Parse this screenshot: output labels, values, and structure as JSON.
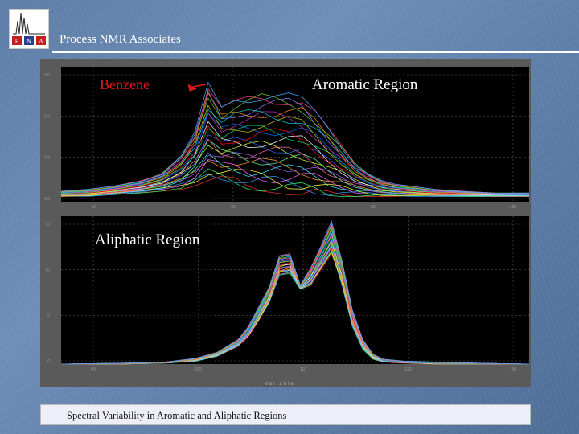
{
  "header": {
    "logo_letters": [
      "P",
      "N",
      "A"
    ],
    "title": "Process NMR Associates"
  },
  "caption": "Spectral Variability in Aromatic and Aliphatic Regions",
  "colors": {
    "plot_background": "#000000",
    "panel_background": "#5a5a5a",
    "annotation_red": "#e01818",
    "annotation_white": "#ffffff"
  },
  "chart_data": [
    {
      "type": "line",
      "region_label": "Aromatic Region",
      "annotation": {
        "text": "Benzene",
        "points_to_x": 41,
        "points_to_y": 0.66
      },
      "xlim": [
        20,
        90
      ],
      "ylim": [
        -0.02,
        0.75
      ],
      "yticks": [
        "0.0",
        "0.2",
        "0.4",
        "0.6"
      ],
      "xticks": [
        "40",
        "60",
        "80",
        "100"
      ],
      "x": [
        20,
        24,
        28,
        32,
        35,
        38,
        40,
        42,
        44,
        46,
        48,
        50,
        52,
        54,
        56,
        58,
        60,
        62,
        64,
        66,
        68,
        70,
        72,
        76,
        80,
        85,
        90
      ],
      "envelope_upper": [
        0.04,
        0.05,
        0.07,
        0.1,
        0.14,
        0.25,
        0.38,
        0.66,
        0.52,
        0.56,
        0.58,
        0.6,
        0.6,
        0.6,
        0.58,
        0.5,
        0.4,
        0.3,
        0.2,
        0.14,
        0.1,
        0.08,
        0.07,
        0.05,
        0.04,
        0.03,
        0.03
      ],
      "envelope_lower": [
        0.01,
        0.01,
        0.02,
        0.03,
        0.04,
        0.05,
        0.07,
        0.1,
        0.1,
        0.08,
        0.05,
        0.04,
        0.03,
        0.02,
        0.02,
        0.02,
        0.01,
        0.01,
        0.01,
        0.01,
        0.01,
        0.01,
        0.01,
        0.01,
        0.01,
        0.01,
        0.01
      ]
    },
    {
      "type": "line",
      "region_label": "Aliphatic Region",
      "xlim": [
        90,
        135
      ],
      "ylim": [
        0,
        1.5
      ],
      "yticks": [
        "0",
        "5",
        "10",
        "15"
      ],
      "xticks": [
        "90",
        "100",
        "110",
        "120",
        "130"
      ],
      "xlabel": "Variable",
      "x": [
        90,
        96,
        100,
        103,
        105,
        107,
        108,
        109,
        110,
        111,
        112,
        113,
        114,
        115,
        116,
        117,
        118,
        119,
        120,
        121,
        123,
        126,
        130,
        135
      ],
      "envelope_upper": [
        0.0,
        0.01,
        0.02,
        0.06,
        0.12,
        0.25,
        0.38,
        0.58,
        0.78,
        1.1,
        1.12,
        0.8,
        0.98,
        1.2,
        1.45,
        1.05,
        0.55,
        0.25,
        0.1,
        0.05,
        0.03,
        0.02,
        0.01,
        0.0
      ],
      "envelope_lower": [
        0.0,
        0.0,
        0.01,
        0.03,
        0.08,
        0.18,
        0.28,
        0.44,
        0.62,
        0.9,
        0.92,
        0.76,
        0.8,
        0.96,
        1.12,
        0.8,
        0.38,
        0.15,
        0.05,
        0.02,
        0.01,
        0.0,
        0.0,
        0.0
      ]
    }
  ]
}
